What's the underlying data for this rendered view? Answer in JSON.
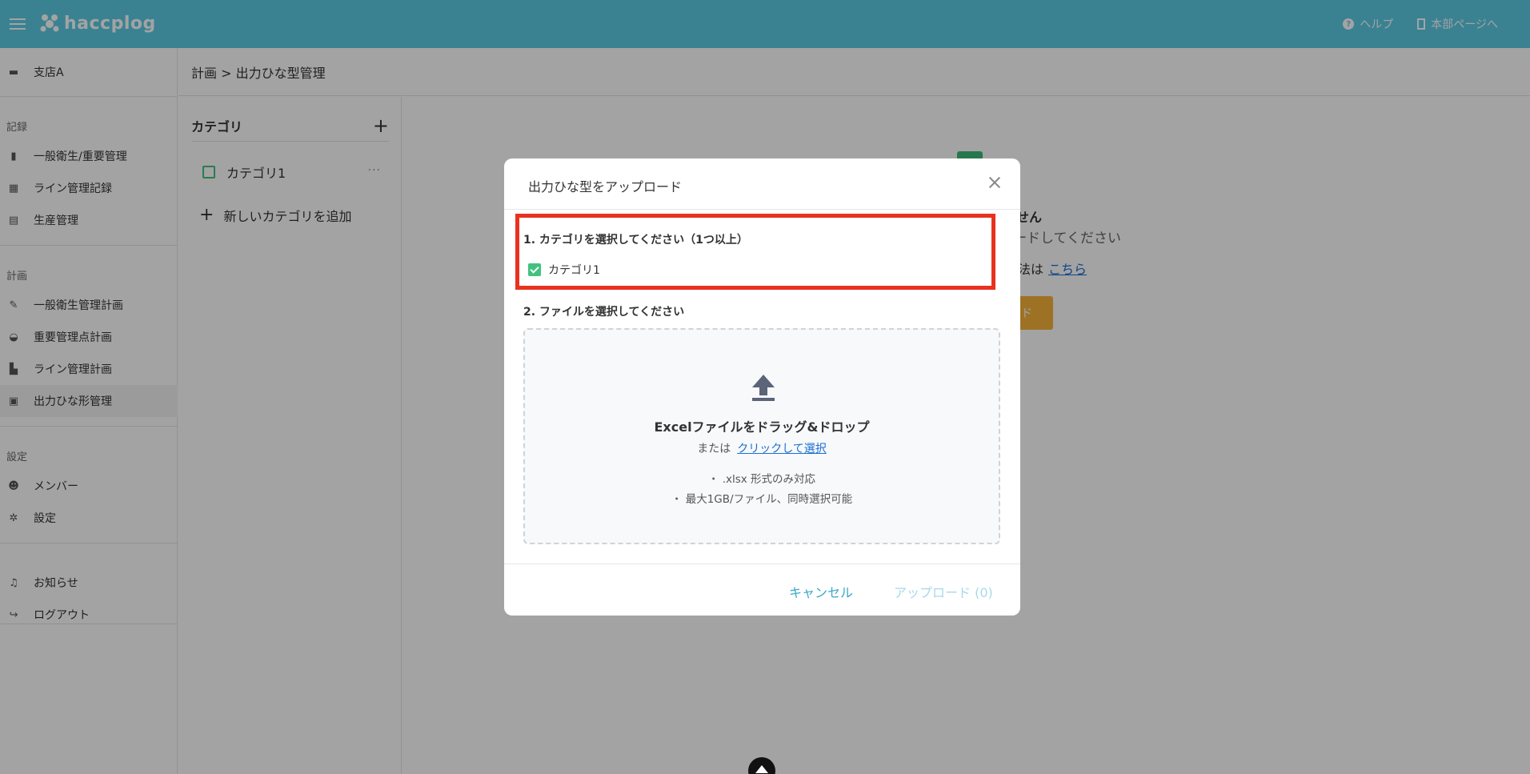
{
  "app": {
    "logo_text": "haccplog"
  },
  "header": {
    "help_label": "ヘルプ",
    "hq_label": "本部ページへ"
  },
  "sidebar": {
    "store": "支店A",
    "sections": {
      "records": "記録",
      "plans": "計画",
      "settings": "設定"
    },
    "items": {
      "general_hygiene": "一般衛生/重要管理",
      "line_record": "ライン管理記録",
      "production": "生産管理",
      "hygiene_plan": "一般衛生管理計画",
      "ccp_plan": "重要管理点計画",
      "line_plan": "ライン管理計画",
      "templates": "出力ひな形管理",
      "members": "メンバー",
      "settings": "設定",
      "notices": "お知らせ",
      "logout": "ログアウト"
    }
  },
  "breadcrumb": "計画 > 出力ひな型管理",
  "category_panel": {
    "title": "カテゴリ",
    "items": [
      {
        "name": "カテゴリ1"
      }
    ],
    "add_label": "新しいカテゴリを追加",
    "more": "···"
  },
  "background": {
    "text1": "せん",
    "text2": "ードしてください",
    "text3": "法は",
    "link": "こちら",
    "button": "ド"
  },
  "modal": {
    "title": "出力ひな型をアップロード",
    "step1_label": "1. カテゴリを選択してください（1つ以上）",
    "options": [
      {
        "label": "カテゴリ1",
        "checked": true
      }
    ],
    "step2_label": "2. ファイルを選択してください",
    "dropzone": {
      "title": "Excelファイルをドラッグ&ドロップ",
      "or_text": "または",
      "link": "クリックして選択",
      "note1": "・ .xlsx 形式のみ対応",
      "note2": "・ 最大1GB/ファイル、同時選択可能"
    },
    "cancel_label": "キャンセル",
    "upload_label": "アップロード (0)"
  },
  "colors": {
    "header": "#5bcbe5",
    "accent_green": "#42c27e",
    "highlight": "#e8321f",
    "link": "#1a6fd1"
  }
}
